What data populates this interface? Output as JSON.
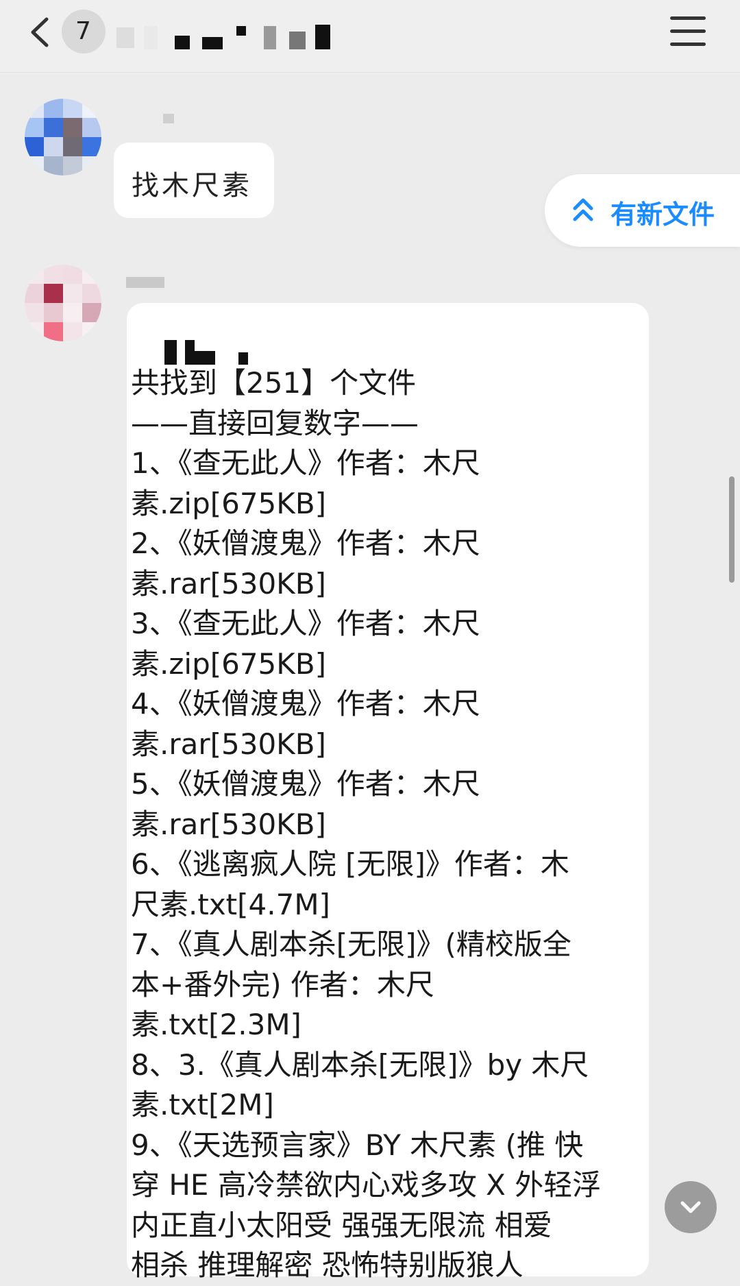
{
  "header": {
    "badge": "7",
    "title_redacted": true
  },
  "messages": [
    {
      "type": "incoming",
      "text": "找木尺素"
    },
    {
      "type": "incoming",
      "lines": [
        "共找到【251】个文件",
        "——直接回复数字——",
        "1、《查无此人》作者：木尺",
        "素.zip[675KB]",
        "2、《妖僧渡鬼》作者：木尺",
        "素.rar[530KB]",
        "3、《查无此人》作者：木尺",
        "素.zip[675KB]",
        "4、《妖僧渡鬼》作者：木尺",
        "素.rar[530KB]",
        "5、《妖僧渡鬼》作者：木尺",
        "素.rar[530KB]",
        "6、《逃离疯人院 [无限]》作者：木",
        "尺素.txt[4.7M]",
        "7、《真人剧本杀[无限]》(精校版全",
        "本+番外完) 作者：木尺",
        "素.txt[2.3M]",
        "8、3.《真人剧本杀[无限]》by 木尺",
        "素.txt[2M]",
        "9、《天选预言家》BY 木尺素 (推 快",
        "穿 HE 高冷禁欲内心戏多攻 X 外轻浮",
        "内正直小太阳受 强强无限流 相爱",
        "相杀 推理解密 恐怖特别版狼人"
      ]
    }
  ],
  "new_file_pill": {
    "label": "有新文件",
    "icon": "double-chevron-up-icon",
    "color": "#1a8cff"
  },
  "icons": {
    "back": "chevron-left-icon",
    "menu": "hamburger-menu-icon",
    "scroll_down": "chevron-down-icon"
  }
}
